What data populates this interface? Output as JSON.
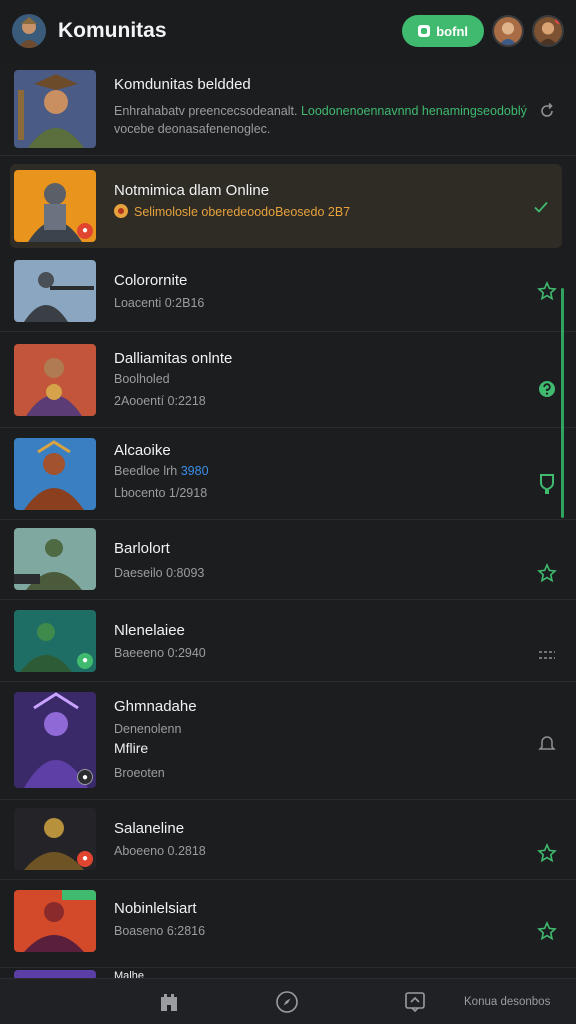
{
  "header": {
    "title": "Komunitas",
    "online_button": "bofnl"
  },
  "rows": [
    {
      "name": "Komdunitas beldded",
      "line1_a": "Enhrahabatv preencecsodeanalt.",
      "line1_b": "Loodonenoennavnnd henamingseodoblý",
      "line2": "vocebe deonasafenenoglec.",
      "status_icon": "refresh-icon"
    },
    {
      "name": "Notmimica dlam Online",
      "line1": "Selimolosle oberedeoodoBeosedo 2B7",
      "status_icon": "checkmark-icon"
    },
    {
      "name": "Colorornite",
      "line1": "Loacenti 0:2B16",
      "status_icon": "star-icon"
    },
    {
      "name": "Dalliamitas onlnte",
      "line1": "Boolholed",
      "line2": "2Aooentí 0:2218",
      "status_icon": "help-icon"
    },
    {
      "name": "Alcaoike",
      "line1_a": "Beedloe lrh",
      "line1_b": "3980",
      "line2": "Lbocento 1/2918",
      "status_icon": "shield-icon"
    },
    {
      "name": "Barlolort",
      "line1": "Daeseilo 0:8093",
      "status_icon": "star-icon"
    },
    {
      "name": "Nlenelaiee",
      "line1": "Baeeeno 0:2940",
      "status_icon": "more-icon"
    },
    {
      "name": "Ghmnadahe",
      "line1": "Denenolenn",
      "line2": "Mflire",
      "line3": "Broeoten",
      "status_icon": "bell-icon"
    },
    {
      "name": "Salaneline",
      "line1": "Aboeeno 0.2818",
      "status_icon": "star-icon"
    },
    {
      "name": "Nobinlelsiart",
      "line1": "Boaseno 6:2816",
      "status_icon": "star-icon"
    },
    {
      "name": "Malhe"
    }
  ],
  "bottom_nav": {
    "item1": "castle-icon",
    "item2": "compass-icon",
    "item3": "chat-icon",
    "item4_label": "Konua desonbos"
  },
  "colors": {
    "accent_green": "#3fba6f",
    "accent_orange": "#e6a23c",
    "accent_blue": "#3a8ee6",
    "background": "#1c1d1f"
  }
}
